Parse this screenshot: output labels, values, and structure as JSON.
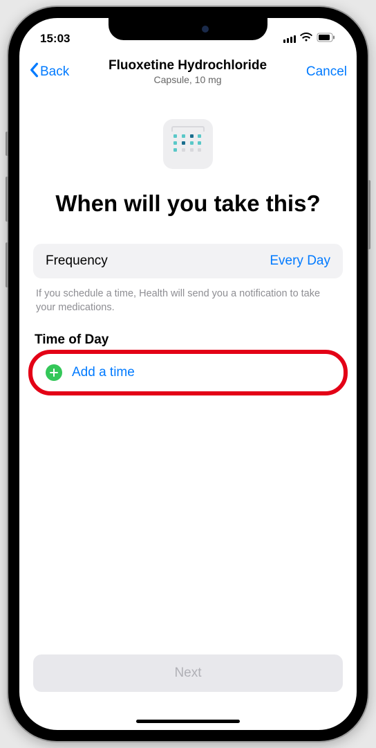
{
  "statusBar": {
    "time": "15:03"
  },
  "nav": {
    "back": "Back",
    "title": "Fluoxetine Hydrochloride",
    "subtitle": "Capsule, 10 mg",
    "cancel": "Cancel"
  },
  "question": "When will you take this?",
  "frequency": {
    "label": "Frequency",
    "value": "Every Day"
  },
  "infoText": "If you schedule a time, Health will send you a notification to take your medications.",
  "timeOfDay": {
    "header": "Time of Day",
    "addLabel": "Add a time"
  },
  "nextButton": "Next"
}
